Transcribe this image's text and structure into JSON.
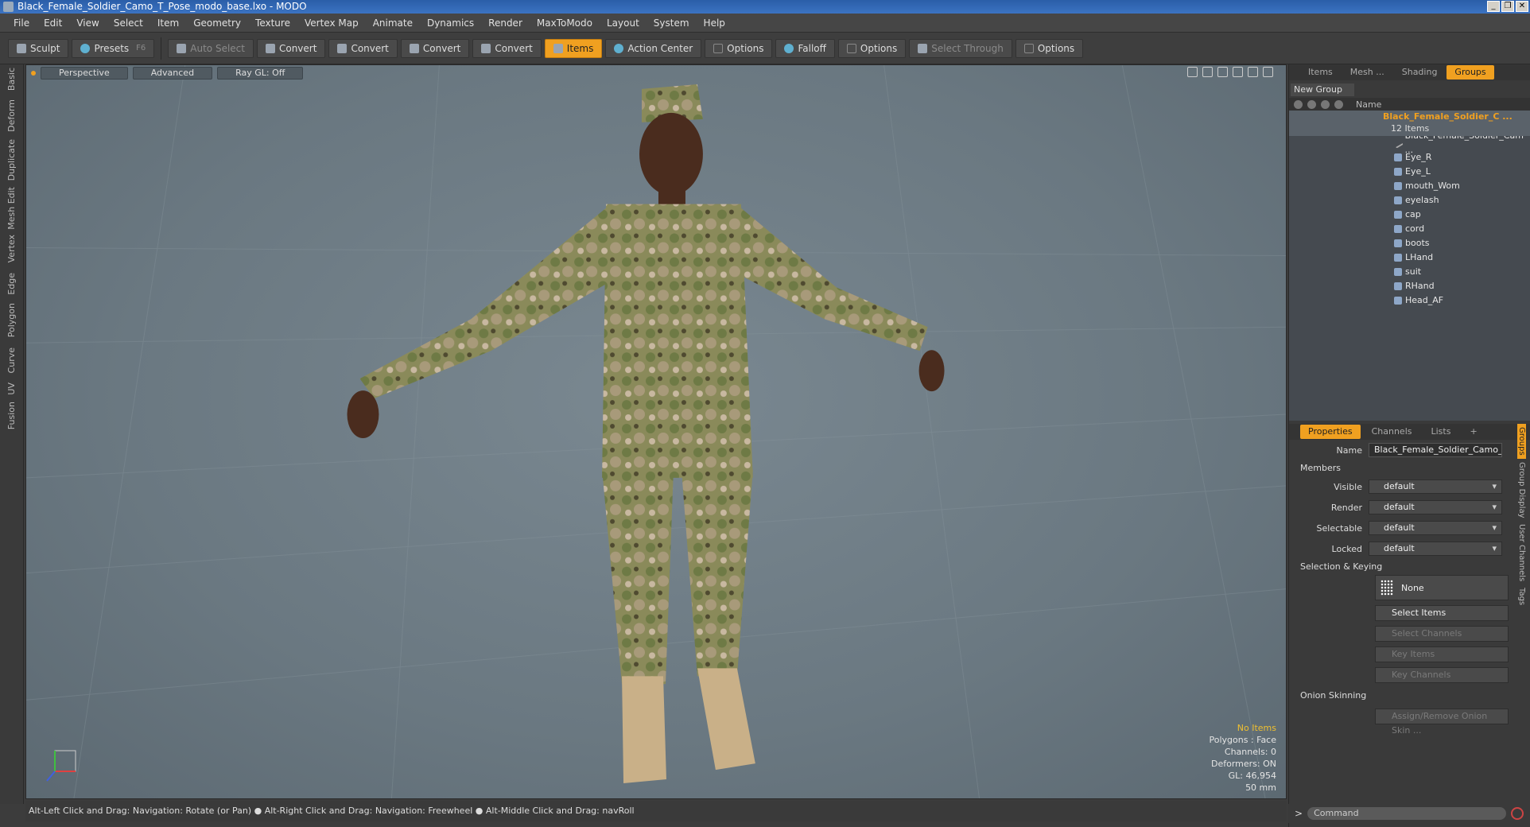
{
  "window": {
    "title": "Black_Female_Soldier_Camo_T_Pose_modo_base.lxo - MODO",
    "controls": [
      "_",
      "❐",
      "✕"
    ]
  },
  "menu": [
    "File",
    "Edit",
    "View",
    "Select",
    "Item",
    "Geometry",
    "Texture",
    "Vertex Map",
    "Animate",
    "Dynamics",
    "Render",
    "MaxToModo",
    "Layout",
    "System",
    "Help"
  ],
  "toolbar": {
    "sculpt": "Sculpt",
    "presets": "Presets",
    "presets_key": "F6",
    "auto_select": "Auto Select",
    "convert1": "Convert",
    "convert2": "Convert",
    "convert3": "Convert",
    "convert4": "Convert",
    "items": "Items",
    "action_center": "Action Center",
    "options1": "Options",
    "falloff": "Falloff",
    "options2": "Options",
    "select_through": "Select Through",
    "options3": "Options"
  },
  "left_tabs": [
    "Basic",
    "Deform",
    "Duplicate",
    "Mesh Edit",
    "Vertex",
    "Edge",
    "Polygon",
    "Curve",
    "UV",
    "Fusion"
  ],
  "viewport": {
    "view": "Perspective",
    "shading": "Advanced",
    "raygl": "Ray GL: Off",
    "info": {
      "selection": "No Items",
      "polygons": "Polygons : Face",
      "channels": "Channels: 0",
      "deformers": "Deformers: ON",
      "gl": "GL: 46,954",
      "scale": "50 mm"
    }
  },
  "status": "Alt-Left Click and Drag: Navigation: Rotate (or Pan) ● Alt-Right Click and Drag: Navigation: Freewheel ● Alt-Middle Click and Drag: navRoll",
  "groups_panel": {
    "tabs": [
      "Items",
      "Mesh ...",
      "Shading",
      "Groups"
    ],
    "new_group": "New Group",
    "col_name": "Name",
    "root": {
      "name": "Black_Female_Soldier_C ...",
      "count": "12 Items"
    },
    "items": [
      "Black_Female_Soldier_Cam ...",
      "Eye_R",
      "Eye_L",
      "mouth_Wom",
      "eyelash",
      "cap",
      "cord",
      "boots",
      "LHand",
      "suit",
      "RHand",
      "Head_AF"
    ]
  },
  "properties": {
    "tabs": [
      "Properties",
      "Channels",
      "Lists",
      "+"
    ],
    "name_label": "Name",
    "name_value": "Black_Female_Soldier_Camo_T_F",
    "members": "Members",
    "visible_label": "Visible",
    "visible": "default",
    "render_label": "Render",
    "render": "default",
    "selectable_label": "Selectable",
    "selectable": "default",
    "locked_label": "Locked",
    "locked": "default",
    "sel_keying": "Selection & Keying",
    "none": "None",
    "select_items": "Select Items",
    "select_channels": "Select Channels",
    "key_items": "Key Items",
    "key_channels": "Key Channels",
    "onion": "Onion Skinning",
    "assign_onion": "Assign/Remove Onion Skin ..."
  },
  "right_vtabs": [
    "Groups",
    "Group Display",
    "User Channels",
    "Tags"
  ],
  "command": {
    "prompt": ">",
    "placeholder": "Command"
  }
}
